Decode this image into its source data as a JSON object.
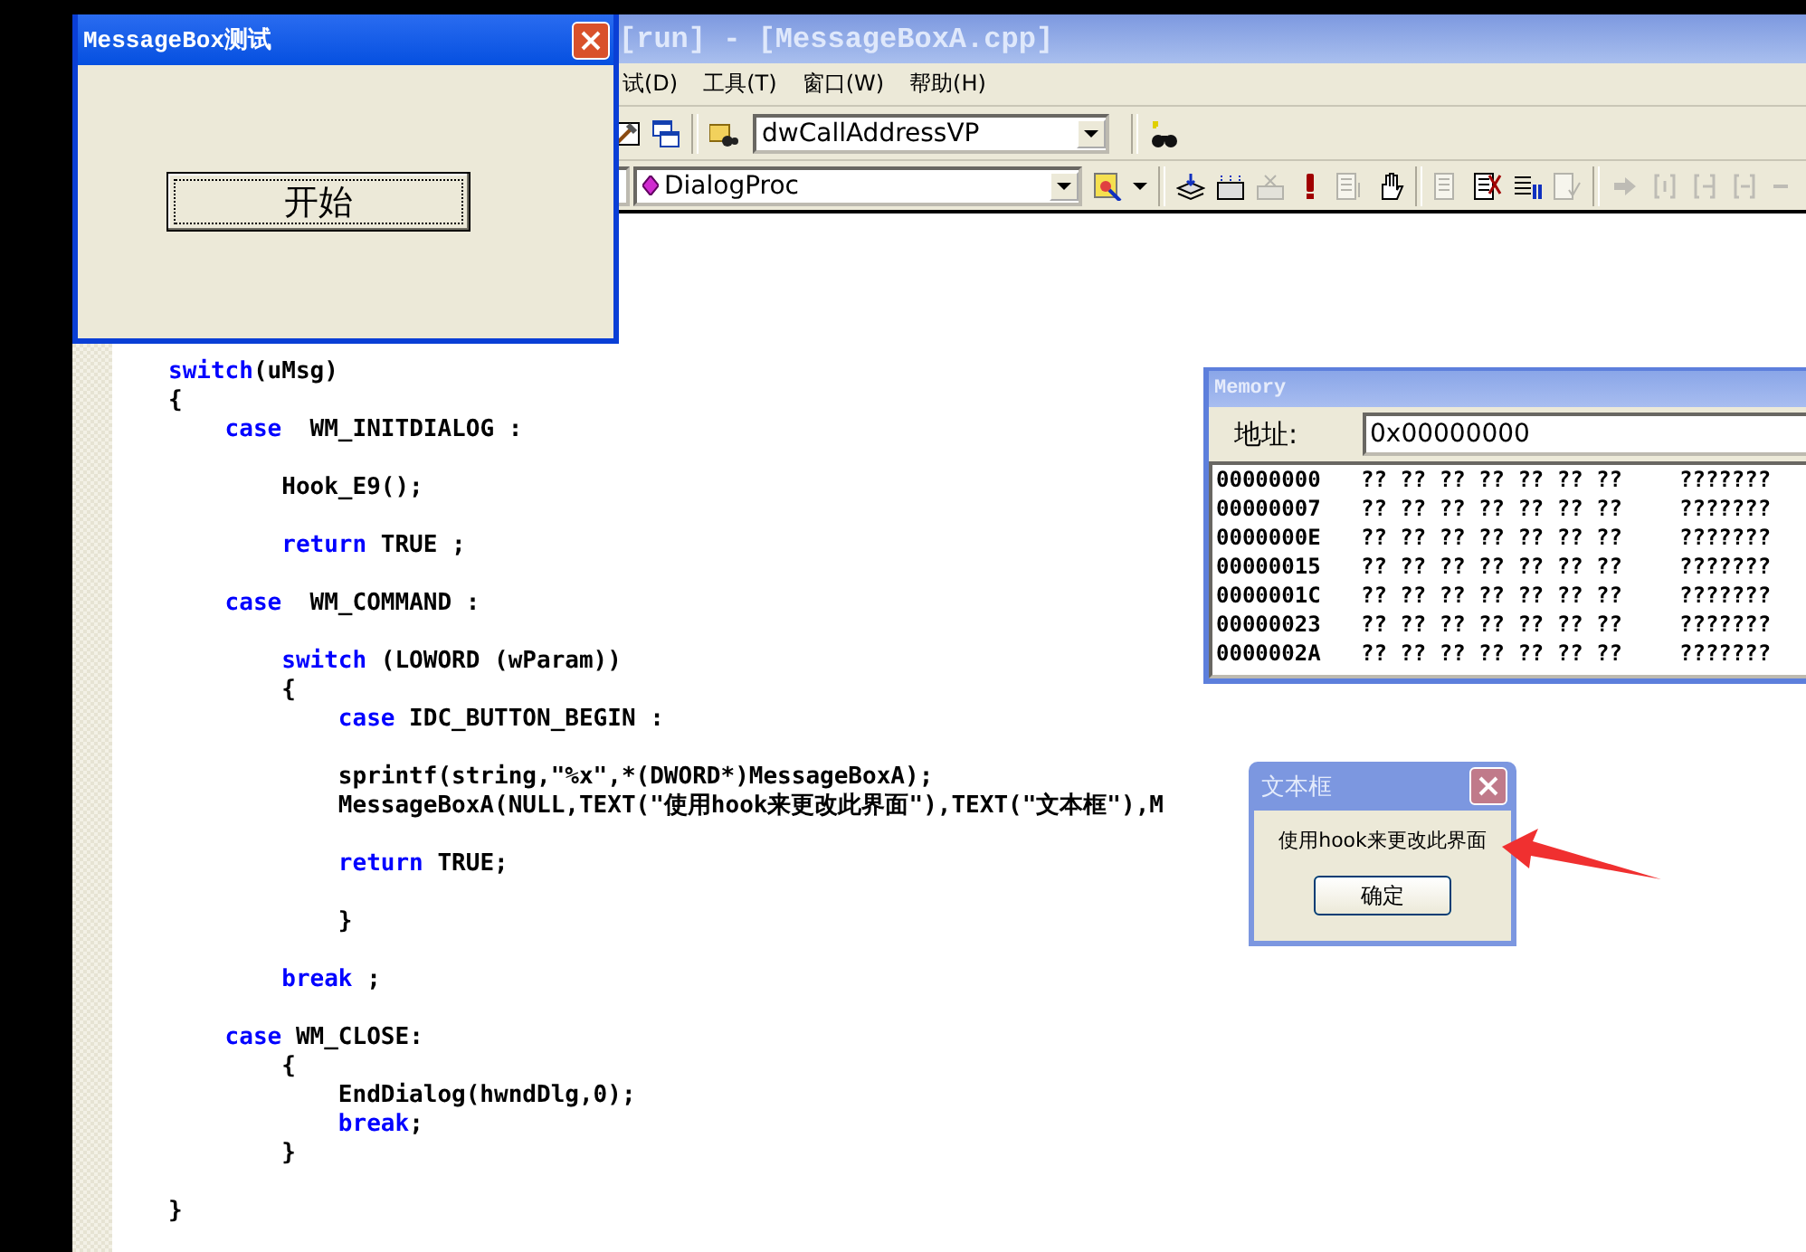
{
  "editor_window": {
    "title": "[run] - [MessageBoxA.cpp]",
    "menu": [
      "试(D)",
      "工具(T)",
      "窗口(W)",
      "帮助(H)"
    ],
    "toolbar": {
      "variable_combo": "dwCallAddressVP",
      "function_combo": "DialogProc"
    },
    "code": [
      {
        "kind": "code",
        "parts": [
          {
            "text": "switch",
            "kind": "keyword"
          },
          {
            "text": "(uMsg)",
            "kind": "plain"
          }
        ]
      },
      {
        "kind": "code",
        "parts": [
          {
            "text": "{",
            "kind": "plain"
          }
        ]
      },
      {
        "kind": "code",
        "parts": [
          {
            "text": "    case",
            "kind": "keyword"
          },
          {
            "text": "  WM_INITDIALOG :",
            "kind": "plain"
          }
        ]
      },
      {
        "kind": "blank"
      },
      {
        "kind": "code",
        "parts": [
          {
            "text": "        Hook_E9();",
            "kind": "plain"
          }
        ]
      },
      {
        "kind": "blank"
      },
      {
        "kind": "code",
        "parts": [
          {
            "text": "        return",
            "kind": "keyword"
          },
          {
            "text": " TRUE ;",
            "kind": "plain"
          }
        ]
      },
      {
        "kind": "blank"
      },
      {
        "kind": "code",
        "parts": [
          {
            "text": "    case",
            "kind": "keyword"
          },
          {
            "text": "  WM_COMMAND :",
            "kind": "plain"
          }
        ]
      },
      {
        "kind": "blank"
      },
      {
        "kind": "code",
        "parts": [
          {
            "text": "        switch",
            "kind": "keyword"
          },
          {
            "text": " (LOWORD (wParam))",
            "kind": "plain"
          }
        ]
      },
      {
        "kind": "code",
        "parts": [
          {
            "text": "        {",
            "kind": "plain"
          }
        ]
      },
      {
        "kind": "code",
        "parts": [
          {
            "text": "            case",
            "kind": "keyword"
          },
          {
            "text": " IDC_BUTTON_BEGIN :",
            "kind": "plain"
          }
        ]
      },
      {
        "kind": "blank"
      },
      {
        "kind": "code",
        "parts": [
          {
            "text": "            sprintf(string,\"%x\",*(DWORD*)MessageBoxA);",
            "kind": "plain"
          }
        ]
      },
      {
        "kind": "code",
        "parts": [
          {
            "text": "            MessageBoxA(NULL,TEXT(\"使用hook来更改此界面\"),TEXT(\"文本框\"),M",
            "kind": "plain"
          }
        ]
      },
      {
        "kind": "blank"
      },
      {
        "kind": "code",
        "parts": [
          {
            "text": "            return",
            "kind": "keyword"
          },
          {
            "text": " TRUE;",
            "kind": "plain"
          }
        ]
      },
      {
        "kind": "blank"
      },
      {
        "kind": "code",
        "parts": [
          {
            "text": "            }",
            "kind": "plain"
          }
        ]
      },
      {
        "kind": "blank"
      },
      {
        "kind": "code",
        "parts": [
          {
            "text": "        break",
            "kind": "keyword"
          },
          {
            "text": " ;",
            "kind": "plain"
          }
        ]
      },
      {
        "kind": "blank"
      },
      {
        "kind": "code",
        "parts": [
          {
            "text": "    case",
            "kind": "keyword"
          },
          {
            "text": " WM_CLOSE:",
            "kind": "plain"
          }
        ]
      },
      {
        "kind": "code",
        "parts": [
          {
            "text": "        {",
            "kind": "plain"
          }
        ]
      },
      {
        "kind": "code",
        "parts": [
          {
            "text": "            EndDialog(hwndDlg,0);",
            "kind": "plain"
          }
        ]
      },
      {
        "kind": "code",
        "parts": [
          {
            "text": "            break",
            "kind": "keyword"
          },
          {
            "text": ";",
            "kind": "plain"
          }
        ]
      },
      {
        "kind": "code",
        "parts": [
          {
            "text": "        }",
            "kind": "plain"
          }
        ]
      },
      {
        "kind": "blank"
      },
      {
        "kind": "code",
        "parts": [
          {
            "text": "}",
            "kind": "plain"
          }
        ]
      }
    ]
  },
  "test_dialog": {
    "title": "MessageBox测试",
    "button": "开始"
  },
  "memory_window": {
    "title": "Memory",
    "address_label": "地址:",
    "address": "0x00000000",
    "rows": [
      {
        "address": "00000000",
        "bytes": "?? ?? ?? ?? ?? ?? ??",
        "ascii": "???????"
      },
      {
        "address": "00000007",
        "bytes": "?? ?? ?? ?? ?? ?? ??",
        "ascii": "???????"
      },
      {
        "address": "0000000E",
        "bytes": "?? ?? ?? ?? ?? ?? ??",
        "ascii": "???????"
      },
      {
        "address": "00000015",
        "bytes": "?? ?? ?? ?? ?? ?? ??",
        "ascii": "???????"
      },
      {
        "address": "0000001C",
        "bytes": "?? ?? ?? ?? ?? ?? ??",
        "ascii": "???????"
      },
      {
        "address": "00000023",
        "bytes": "?? ?? ?? ?? ?? ?? ??",
        "ascii": "???????"
      },
      {
        "address": "0000002A",
        "bytes": "?? ?? ?? ?? ?? ?? ??",
        "ascii": "???????"
      }
    ]
  },
  "message_box": {
    "title": "文本框",
    "message": "使用hook来更改此界面",
    "button": "确定"
  }
}
